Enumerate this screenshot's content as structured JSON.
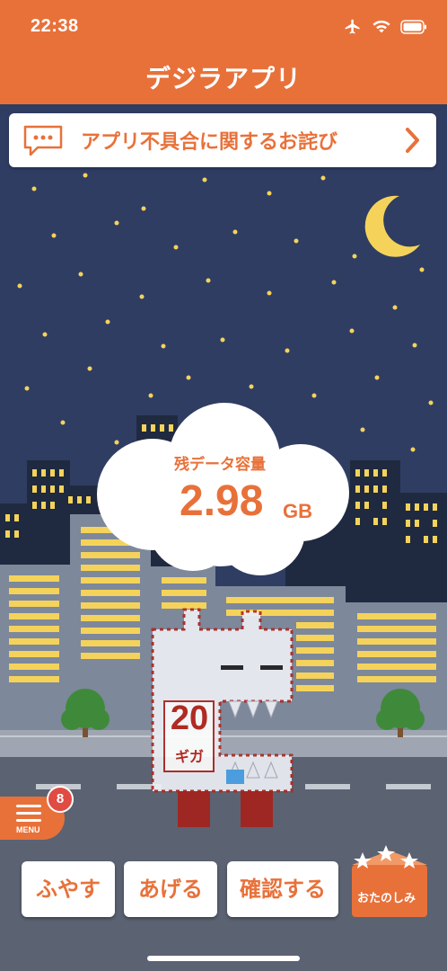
{
  "status_bar": {
    "time": "22:38",
    "icons": [
      "airplane-icon",
      "wifi-icon",
      "battery-icon"
    ]
  },
  "header": {
    "title": "デジラアプリ"
  },
  "notice": {
    "text": "アプリ不具合に関するお詫び",
    "icon": "chat-bubble-icon",
    "chevron": "chevron-right-icon"
  },
  "data_remaining": {
    "title": "残データ容量",
    "value": "2.98",
    "unit": "GB"
  },
  "mascot": {
    "number": "20",
    "unit": "ギガ"
  },
  "menu": {
    "label": "MENU",
    "badge": "8"
  },
  "actions": [
    {
      "label": "ふやす"
    },
    {
      "label": "あげる"
    },
    {
      "label": "確認する"
    },
    {
      "label": "おたのしみ"
    }
  ],
  "colors": {
    "brand": "#e8713a",
    "sky": "#2f3d63",
    "window": "#f5d35a",
    "badge": "#e04b43"
  }
}
